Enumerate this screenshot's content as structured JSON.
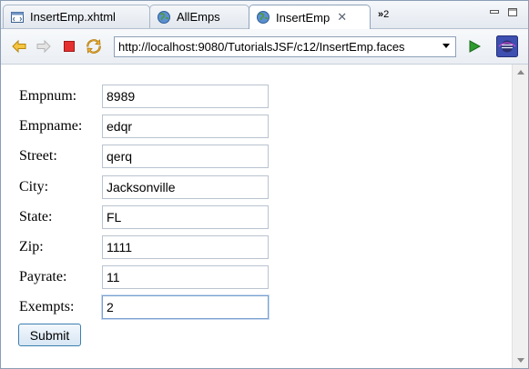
{
  "tabs": [
    {
      "label": "InsertEmp.xhtml",
      "icon": "xhtml-file-icon",
      "active": false
    },
    {
      "label": "AllEmps",
      "icon": "globe-icon",
      "active": false
    },
    {
      "label": "InsertEmp",
      "icon": "globe-icon",
      "active": true
    }
  ],
  "overflow_tabs": {
    "icon": "chevron-double-right-icon",
    "count": "2"
  },
  "window_controls": [
    "minimize-icon",
    "maximize-icon"
  ],
  "toolbar": {
    "back_icon": "back-arrow-icon",
    "forward_icon": "forward-arrow-icon",
    "stop_icon": "stop-icon",
    "refresh_icon": "refresh-icon",
    "url": "http://localhost:9080/TutorialsJSF/c12/InsertEmp.faces",
    "go_icon": "go-play-icon",
    "browser_icon": "eclipse-browser-icon"
  },
  "form": {
    "fields": [
      {
        "label": "Empnum:",
        "value": "8989"
      },
      {
        "label": "Empname:",
        "value": "edqr"
      },
      {
        "label": "Street:",
        "value": "qerq"
      },
      {
        "label": "City:",
        "value": "Jacksonville"
      },
      {
        "label": "State:",
        "value": "FL"
      },
      {
        "label": "Zip:",
        "value": "1111"
      },
      {
        "label": "Payrate:",
        "value": "11"
      },
      {
        "label": "Exempts:",
        "value": "2"
      }
    ],
    "submit_label": "Submit"
  },
  "colors": {
    "accent": "#3c7fb1",
    "stop": "#e53030",
    "go": "#2e9b2e"
  }
}
